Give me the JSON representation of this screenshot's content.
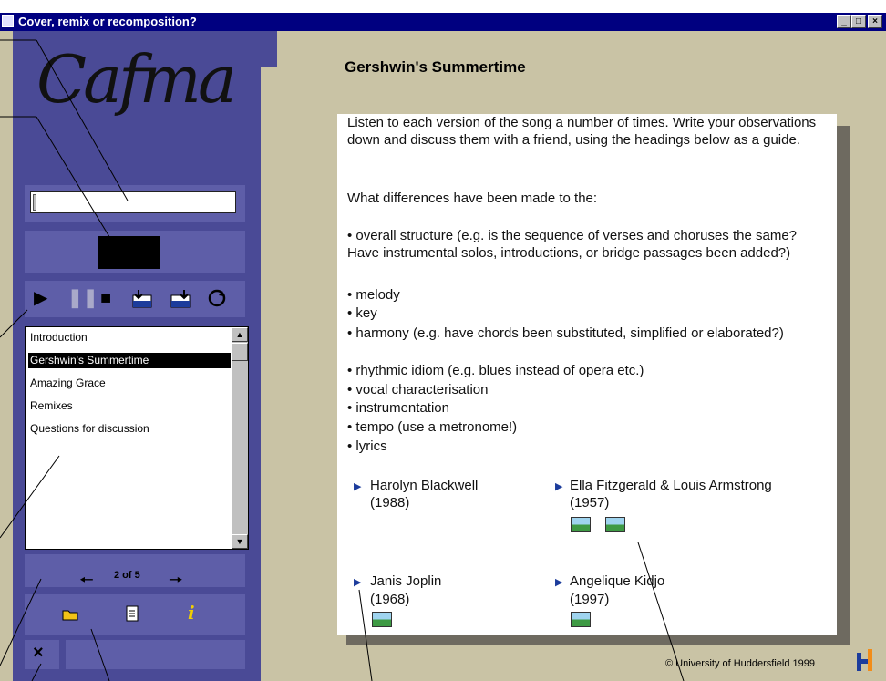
{
  "window": {
    "title": "Cover, remix or recomposition?",
    "buttons": [
      "_",
      "□",
      "×"
    ]
  },
  "logo": {
    "text": "Cafma"
  },
  "player": {
    "controls": [
      "play-icon",
      "pause-icon",
      "stop-icon",
      "load-in-icon",
      "load-out-icon",
      "loop-icon"
    ]
  },
  "playlist": {
    "items": [
      "Introduction",
      "Gershwin's Summertime",
      "Amazing Grace",
      "Remixes",
      "Questions for discussion"
    ],
    "selected": "Gershwin's Summertime"
  },
  "pager": {
    "label": "2 of 5"
  },
  "content": {
    "title": "Gershwin's Summertime",
    "intro": "Listen to each version of the song a number of times. Write your observations down and discuss them with a friend, using the headings below as a guide.",
    "question": "What differences have been made to the:",
    "bullets": [
      "• overall structure (e.g. is the sequence of verses and choruses the same? Have instrumental solos, introductions, or bridge passages been added?)",
      "• melody",
      "• key",
      "• harmony (e.g. have chords been substituted, simplified or elaborated?)",
      "• rhythmic idiom (e.g. blues instead of opera etc.)",
      "• vocal characterisation",
      "• instrumentation",
      "• tempo (use a metronome!)",
      "• lyrics"
    ],
    "songs": [
      {
        "artist": "Harolyn Blackwell",
        "year": "(1988)"
      },
      {
        "artist": "Ella Fitzgerald & Louis Armstrong",
        "year": "(1957)"
      },
      {
        "artist": "Janis Joplin",
        "year": "(1968)"
      },
      {
        "artist": "Angelique Kidjo",
        "year": "(1997)"
      }
    ]
  },
  "footer": {
    "copyright": "© University of Huddersfield 1999"
  },
  "colors": {
    "panel": "#4a4a96",
    "titlebar": "#000080",
    "link_arrow": "#1c3c9c"
  }
}
